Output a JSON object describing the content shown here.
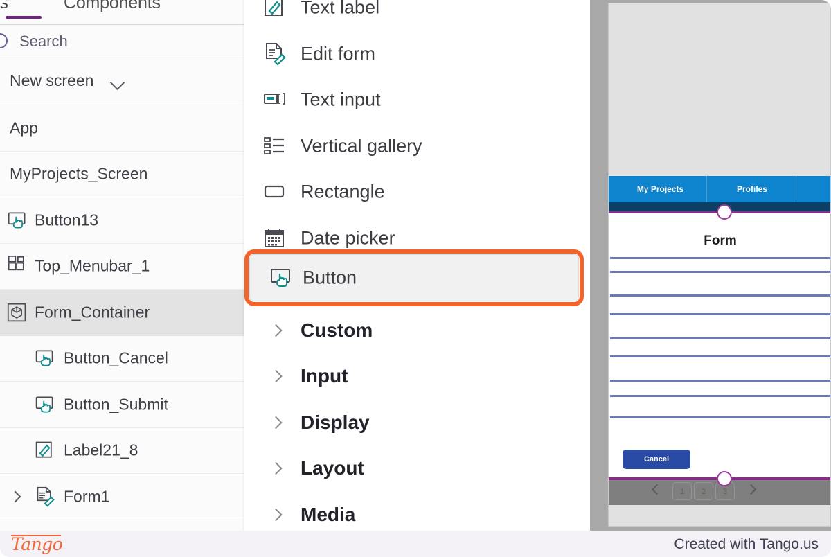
{
  "left_panel": {
    "tabs": [
      {
        "label": "ens",
        "full": "Screens",
        "active": true
      },
      {
        "label": "Components",
        "active": false
      }
    ],
    "search": {
      "placeholder": "Search",
      "value": "",
      "icon": "search-icon"
    },
    "new_screen": {
      "label": "New screen",
      "icon": "chevron-down-icon"
    },
    "tree": [
      {
        "label": "App",
        "depth": 0,
        "icon": null,
        "selected": false,
        "expandable": false
      },
      {
        "label": "MyProjects_Screen",
        "depth": 0,
        "icon": null,
        "selected": false,
        "expandable": false
      },
      {
        "label": "Button13",
        "depth": 1,
        "icon": "button-icon",
        "selected": false,
        "expandable": false
      },
      {
        "label": "Top_Menubar_1",
        "depth": 1,
        "icon": "layout-grid-icon",
        "selected": false,
        "expandable": false
      },
      {
        "label": "Form_Container",
        "depth": 1,
        "icon": "container-cube-icon",
        "selected": true,
        "expandable": false
      },
      {
        "label": "Button_Cancel",
        "depth": 2,
        "icon": "button-icon",
        "selected": false,
        "expandable": false
      },
      {
        "label": "Button_Submit",
        "depth": 2,
        "icon": "button-icon",
        "selected": false,
        "expandable": false
      },
      {
        "label": "Label21_8",
        "depth": 2,
        "icon": "text-label-icon",
        "selected": false,
        "expandable": false
      },
      {
        "label": "Form1",
        "depth": 2,
        "icon": "edit-form-icon",
        "selected": false,
        "expandable": true
      }
    ]
  },
  "insert_menu": {
    "items": [
      {
        "label": "Text label",
        "icon": "text-label-icon",
        "type": "component",
        "highlighted": false
      },
      {
        "label": "Edit form",
        "icon": "edit-form-icon",
        "type": "component",
        "highlighted": false
      },
      {
        "label": "Text input",
        "icon": "text-input-icon",
        "type": "component",
        "highlighted": false
      },
      {
        "label": "Vertical gallery",
        "icon": "vertical-gallery-icon",
        "type": "component",
        "highlighted": false
      },
      {
        "label": "Rectangle",
        "icon": "rectangle-icon",
        "type": "component",
        "highlighted": false
      },
      {
        "label": "Date picker",
        "icon": "date-picker-icon",
        "type": "component",
        "highlighted": false
      },
      {
        "label": "Button",
        "icon": "button-icon",
        "type": "component",
        "highlighted": true
      },
      {
        "label": "Custom",
        "icon": "chevron-right-icon",
        "type": "category",
        "highlighted": false
      },
      {
        "label": "Input",
        "icon": "chevron-right-icon",
        "type": "category",
        "highlighted": false
      },
      {
        "label": "Display",
        "icon": "chevron-right-icon",
        "type": "category",
        "highlighted": false
      },
      {
        "label": "Layout",
        "icon": "chevron-right-icon",
        "type": "category",
        "highlighted": false
      },
      {
        "label": "Media",
        "icon": "chevron-right-icon",
        "type": "category",
        "highlighted": false
      }
    ],
    "highlight_color": "#f4642a",
    "scrollbar": {
      "visible": true
    }
  },
  "app_preview": {
    "nav_tabs": [
      {
        "label": "My Projects"
      },
      {
        "label": "Profiles"
      }
    ],
    "form_title": "Form",
    "form_line_count": 9,
    "cancel_button": {
      "label": "Cancel"
    },
    "pager": {
      "prev_icon": "chevron-left-icon",
      "next_icon": "chevron-right-icon",
      "pages": [
        "1",
        "2",
        "3"
      ]
    },
    "colors": {
      "nav_bar": "#0d84cd",
      "nav_strip": "#0b3f63",
      "selection": "#8d2a8d",
      "cancel": "#2a4ba5",
      "pager_bg": "#7f7f7f"
    }
  },
  "footer": {
    "logo": "Tango",
    "credit": "Created with Tango.us"
  }
}
